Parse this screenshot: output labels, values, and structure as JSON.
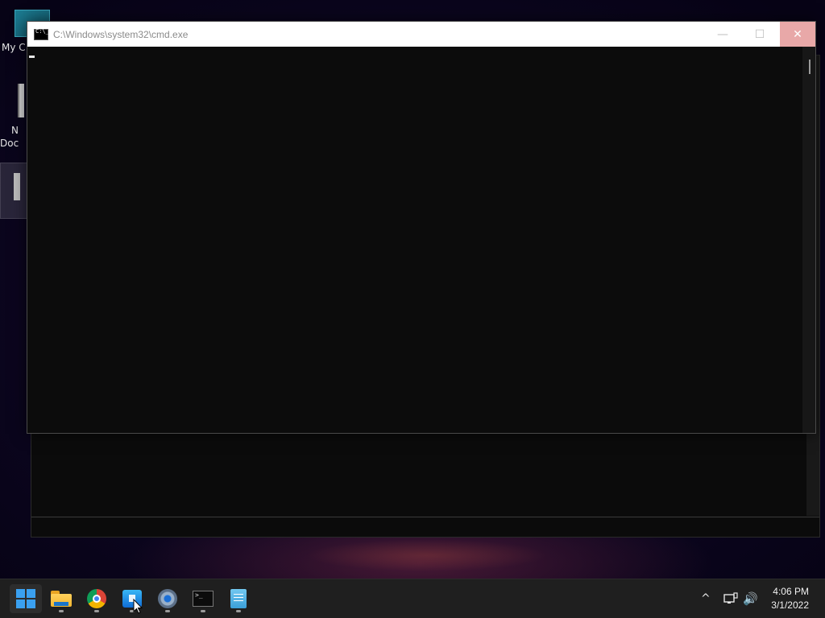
{
  "desktop": {
    "icons": [
      {
        "label": "My C"
      },
      {
        "label_line1": "N",
        "label_line2": "Doc"
      }
    ]
  },
  "cmd_window": {
    "title": "C:\\Windows\\system32\\cmd.exe",
    "minimize_glyph": "—",
    "maximize_glyph": "☐",
    "close_glyph": "✕"
  },
  "taskbar": {
    "apps": [
      {
        "icon": "windows-start-icon",
        "label": "Start"
      },
      {
        "icon": "file-explorer-icon",
        "label": "File Explorer"
      },
      {
        "icon": "chrome-icon",
        "label": "Google Chrome"
      },
      {
        "icon": "microsoft-store-icon",
        "label": "Microsoft Store"
      },
      {
        "icon": "settings-gear-icon",
        "label": "Settings"
      },
      {
        "icon": "command-prompt-icon",
        "label": "Command Prompt"
      },
      {
        "icon": "notepad-icon",
        "label": "Notepad"
      }
    ],
    "tray": {
      "chevron": "^",
      "network_icon": "network-icon",
      "volume_glyph": "🔊",
      "time": "4:06 PM",
      "date": "3/1/2022"
    }
  },
  "colors": {
    "taskbar_bg": "#1f1f1f",
    "console_bg": "#0c0c0c",
    "close_button": "#e8a8a8",
    "accent": "#3aa0f0"
  }
}
